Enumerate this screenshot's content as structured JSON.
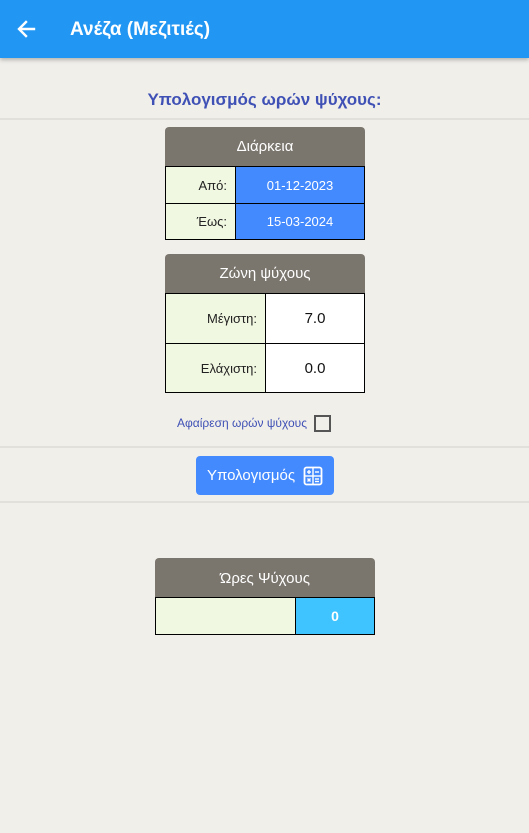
{
  "appbar": {
    "title": "Ανέζα (Μεζιτιές)",
    "color": "#2196f3"
  },
  "main": {
    "section_title": "Υπολογισμός ωρών ψύχους:",
    "duration": {
      "header": "Διάρκεια",
      "from_label": "Από:",
      "from_value": "01-12-2023",
      "to_label": "Έως:",
      "to_value": "15-03-2024"
    },
    "chill_zone": {
      "header": "Ζώνη ψύχους",
      "max_label": "Μέγιστη:",
      "max_value": "7.0",
      "min_label": "Ελάχιστη:",
      "min_value": "0.0"
    },
    "subtract": {
      "label": "Αφαίρεση ωρών ψύχους",
      "checked": false
    },
    "calculate_button": {
      "label": "Υπολογισμός",
      "icon": "calculator-icon"
    },
    "result": {
      "header": "Ώρες Ψύχους",
      "label": "",
      "value": "0"
    }
  },
  "colors": {
    "accent_blue": "#448aff",
    "header_gray": "#7a756d",
    "label_green": "#f1f8e1",
    "result_cyan": "#40c4ff",
    "title_indigo": "#3f51b5"
  }
}
